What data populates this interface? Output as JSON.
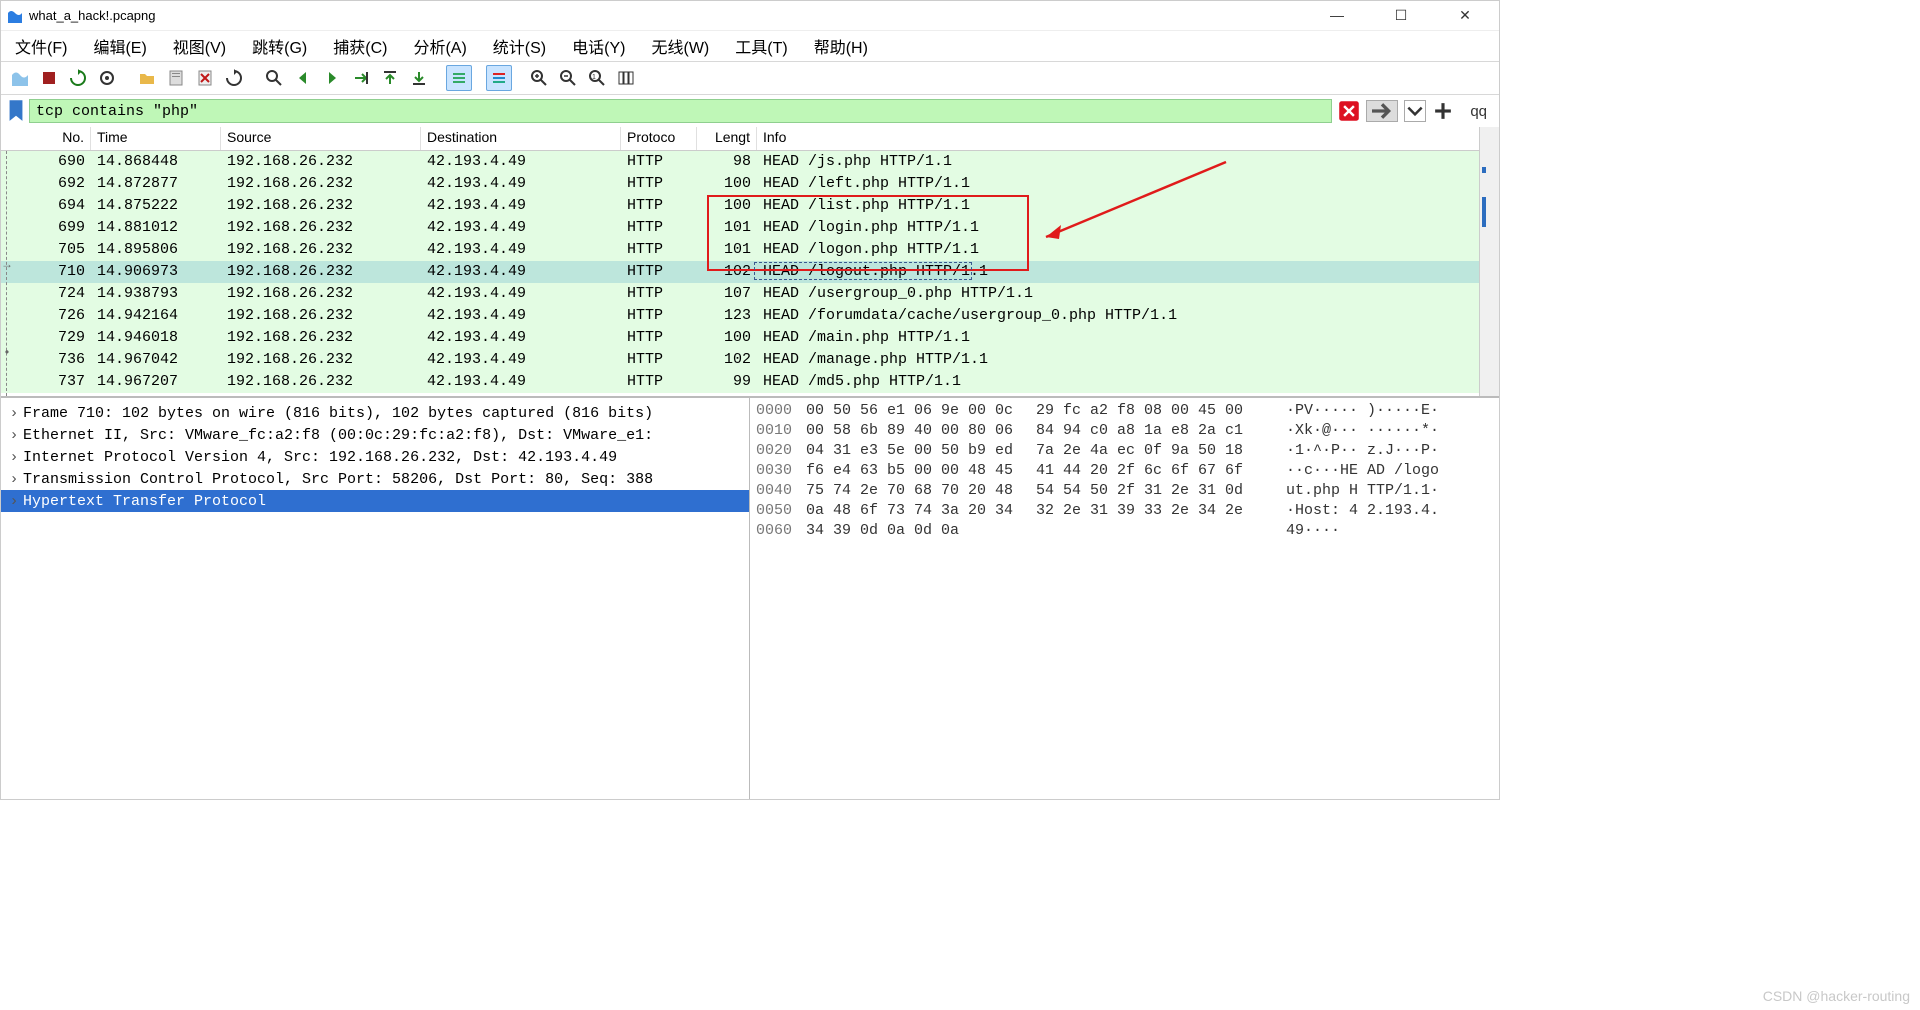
{
  "window": {
    "title": "what_a_hack!.pcapng"
  },
  "menu": {
    "file": "文件(F)",
    "edit": "编辑(E)",
    "view": "视图(V)",
    "go": "跳转(G)",
    "capture": "捕获(C)",
    "analyze": "分析(A)",
    "stats": "统计(S)",
    "telephony": "电话(Y)",
    "wireless": "无线(W)",
    "tools": "工具(T)",
    "help": "帮助(H)"
  },
  "filter": {
    "value": "tcp contains \"php\"",
    "qq": "qq"
  },
  "columns": {
    "no": "No.",
    "time": "Time",
    "source": "Source",
    "destination": "Destination",
    "protocol": "Protoco",
    "length": "Lengt",
    "info": "Info"
  },
  "packets": [
    {
      "no": "690",
      "time": "14.868448",
      "src": "192.168.26.232",
      "dst": "42.193.4.49",
      "proto": "HTTP",
      "len": "98",
      "info": "HEAD /js.php HTTP/1.1",
      "sel": false
    },
    {
      "no": "692",
      "time": "14.872877",
      "src": "192.168.26.232",
      "dst": "42.193.4.49",
      "proto": "HTTP",
      "len": "100",
      "info": "HEAD /left.php HTTP/1.1",
      "sel": false
    },
    {
      "no": "694",
      "time": "14.875222",
      "src": "192.168.26.232",
      "dst": "42.193.4.49",
      "proto": "HTTP",
      "len": "100",
      "info": "HEAD /list.php HTTP/1.1",
      "sel": false
    },
    {
      "no": "699",
      "time": "14.881012",
      "src": "192.168.26.232",
      "dst": "42.193.4.49",
      "proto": "HTTP",
      "len": "101",
      "info": "HEAD /login.php HTTP/1.1",
      "sel": false
    },
    {
      "no": "705",
      "time": "14.895806",
      "src": "192.168.26.232",
      "dst": "42.193.4.49",
      "proto": "HTTP",
      "len": "101",
      "info": "HEAD /logon.php HTTP/1.1",
      "sel": false
    },
    {
      "no": "710",
      "time": "14.906973",
      "src": "192.168.26.232",
      "dst": "42.193.4.49",
      "proto": "HTTP",
      "len": "102",
      "info": "HEAD /logout.php HTTP/1.1",
      "sel": true
    },
    {
      "no": "724",
      "time": "14.938793",
      "src": "192.168.26.232",
      "dst": "42.193.4.49",
      "proto": "HTTP",
      "len": "107",
      "info": "HEAD /usergroup_0.php HTTP/1.1",
      "sel": false
    },
    {
      "no": "726",
      "time": "14.942164",
      "src": "192.168.26.232",
      "dst": "42.193.4.49",
      "proto": "HTTP",
      "len": "123",
      "info": "HEAD /forumdata/cache/usergroup_0.php HTTP/1.1",
      "sel": false
    },
    {
      "no": "729",
      "time": "14.946018",
      "src": "192.168.26.232",
      "dst": "42.193.4.49",
      "proto": "HTTP",
      "len": "100",
      "info": "HEAD /main.php HTTP/1.1",
      "sel": false
    },
    {
      "no": "736",
      "time": "14.967042",
      "src": "192.168.26.232",
      "dst": "42.193.4.49",
      "proto": "HTTP",
      "len": "102",
      "info": "HEAD /manage.php HTTP/1.1",
      "sel": false
    },
    {
      "no": "737",
      "time": "14.967207",
      "src": "192.168.26.232",
      "dst": "42.193.4.49",
      "proto": "HTTP",
      "len": "99",
      "info": "HEAD /md5.php HTTP/1.1",
      "sel": false
    }
  ],
  "tree": {
    "lines": [
      "Frame 710: 102 bytes on wire (816 bits), 102 bytes captured (816 bits)",
      "Ethernet II, Src: VMware_fc:a2:f8 (00:0c:29:fc:a2:f8), Dst: VMware_e1:",
      "Internet Protocol Version 4, Src: 192.168.26.232, Dst: 42.193.4.49",
      "Transmission Control Protocol, Src Port: 58206, Dst Port: 80, Seq: 388",
      "Hypertext Transfer Protocol"
    ],
    "selected_index": 4
  },
  "hex": [
    {
      "off": "0000",
      "b1": "00 50 56 e1 06 9e 00 0c",
      "b2": "29 fc a2 f8 08 00 45 00",
      "a": "·PV····· )·····E·"
    },
    {
      "off": "0010",
      "b1": "00 58 6b 89 40 00 80 06",
      "b2": "84 94 c0 a8 1a e8 2a c1",
      "a": "·Xk·@··· ······*·"
    },
    {
      "off": "0020",
      "b1": "04 31 e3 5e 00 50 b9 ed",
      "b2": "7a 2e 4a ec 0f 9a 50 18",
      "a": "·1·^·P·· z.J···P·"
    },
    {
      "off": "0030",
      "b1": "f6 e4 63 b5 00 00 48 45",
      "b2": "41 44 20 2f 6c 6f 67 6f",
      "a": "··c···HE AD /logo"
    },
    {
      "off": "0040",
      "b1": "75 74 2e 70 68 70 20 48",
      "b2": "54 54 50 2f 31 2e 31 0d",
      "a": "ut.php H TTP/1.1·"
    },
    {
      "off": "0050",
      "b1": "0a 48 6f 73 74 3a 20 34",
      "b2": "32 2e 31 39 33 2e 34 2e",
      "a": "·Host: 4 2.193.4."
    },
    {
      "off": "0060",
      "b1": "34 39 0d 0a 0d 0a",
      "b2": "",
      "a": "49····"
    }
  ],
  "watermark": "CSDN @hacker-routing"
}
